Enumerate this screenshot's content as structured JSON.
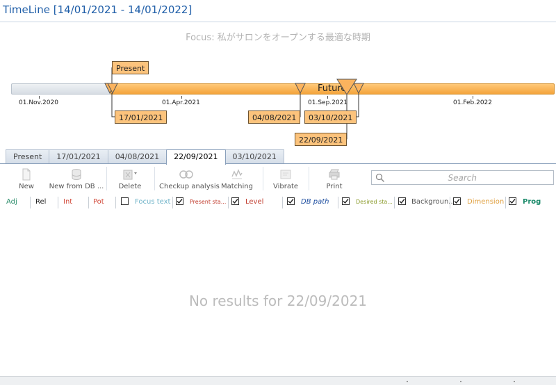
{
  "window": {
    "title": "TimeLine [14/01/2021 - 14/01/2022]"
  },
  "focus": "Focus: 私がサロンをオープンする最適な時期",
  "timeline": {
    "future_label": "Future",
    "axis_labels": [
      "01.Nov.2020",
      "01.Apr.2021",
      "01.Sep.2021",
      "01.Feb.2022"
    ],
    "markers": {
      "present": "Present",
      "d1": "17/01/2021",
      "d2": "04/08/2021",
      "d3": "03/10/2021",
      "d4": "22/09/2021"
    },
    "colors": {
      "future": "#f4a43c",
      "box": "#fcc37c"
    }
  },
  "tabs": [
    "Present",
    "17/01/2021",
    "04/08/2021",
    "22/09/2021",
    "03/10/2021"
  ],
  "active_tab": "22/09/2021",
  "toolbar": {
    "new": "New",
    "new_from_db": "New from DB ...",
    "delete": "Delete",
    "checkup": "Checkup analysis",
    "matching": "Matching",
    "vibrate": "Vibrate",
    "print": "Print"
  },
  "search": {
    "placeholder": "Search"
  },
  "filters": {
    "adj": "Adj",
    "rel": "Rel",
    "int": "Int",
    "pot": "Pot",
    "focus_text": "Focus text",
    "present_state": "Present sta...",
    "level": "Level",
    "db_path": "DB path",
    "desired_state": "Desired sta...",
    "background": "Backgroun...",
    "dimension": "Dimension",
    "prog": "Prog",
    "colors": {
      "adj": "#2a8c6a",
      "rel": "#222222",
      "int": "#d24a3a",
      "pot": "#d24a3a",
      "focus_text": "#6fb3c8",
      "present_state": "#c0392b",
      "level": "#c0392b",
      "db_path": "#1f4fa0",
      "desired_state": "#8a9a2a",
      "background": "#555555",
      "dimension": "#e0a040",
      "prog": "#1a8a6a"
    }
  },
  "empty_message": "No results for 22/09/2021"
}
